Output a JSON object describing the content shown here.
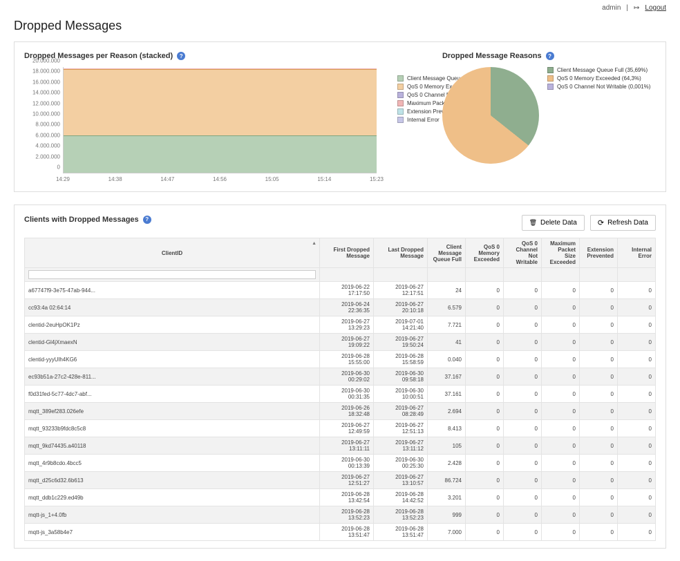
{
  "header": {
    "user": "admin",
    "logout_label": "Logout"
  },
  "page": {
    "title": "Dropped Messages"
  },
  "stacked": {
    "title": "Dropped Messages per Reason (stacked)",
    "legend": [
      "Client Message Queue Full",
      "QoS 0 Memory Exceeded",
      "QoS 0 Channel Not Writable",
      "Maximum Packet Size Exceeded",
      "Extension Prevented",
      "Internal Error"
    ]
  },
  "pie": {
    "title": "Dropped Message Reasons",
    "legend": {
      "a": "Client Message Queue Full (35,69%)",
      "b": "QoS 0 Memory Exceeded (64,3%)",
      "c": "QoS 0 Channel Not Writable (0,001%)"
    }
  },
  "chart_data": [
    {
      "type": "area",
      "title": "Dropped Messages per Reason (stacked)",
      "x_labels": [
        "14:29",
        "14:38",
        "14:47",
        "14:56",
        "15:05",
        "15:14",
        "15:23"
      ],
      "y_ticks": [
        "0",
        "2.000.000",
        "4.000.000",
        "6.000.000",
        "8.000.000",
        "10.000.000",
        "12.000.000",
        "14.000.000",
        "16.000.000",
        "18.000.000",
        "20.000.000"
      ],
      "ylim": [
        0,
        20000000
      ],
      "series": [
        {
          "name": "Client Message Queue Full",
          "color": "#b6d0b6",
          "approx_constant": 7000000
        },
        {
          "name": "QoS 0 Memory Exceeded",
          "color": "#f3cfa2",
          "approx_constant": 12600000
        },
        {
          "name": "QoS 0 Channel Not Writable",
          "color": "#b9b2dc",
          "approx_constant": 0
        },
        {
          "name": "Maximum Packet Size Exceeded",
          "color": "#f0b6b6",
          "approx_constant": 0
        },
        {
          "name": "Extension Prevented",
          "color": "#bfe3e8",
          "approx_constant": 0
        },
        {
          "name": "Internal Error",
          "color": "#c7c7e8",
          "approx_constant": 0
        }
      ],
      "note": "stacked total ≈ 19.6M across full time range; top edge shows thin traces for remaining series"
    },
    {
      "type": "pie",
      "title": "Dropped Message Reasons",
      "slices": [
        {
          "name": "Client Message Queue Full",
          "pct": 35.69,
          "color": "#8fae8f"
        },
        {
          "name": "QoS 0 Memory Exceeded",
          "pct": 64.3,
          "color": "#efbf88"
        },
        {
          "name": "QoS 0 Channel Not Writable",
          "pct": 0.001,
          "color": "#b9b2dc"
        }
      ]
    }
  ],
  "clients": {
    "title": "Clients with Dropped Messages",
    "buttons": {
      "delete": "Delete Data",
      "refresh": "Refresh Data"
    },
    "columns": {
      "client": "ClientID",
      "first": "First Dropped Message",
      "last": "Last Dropped Message",
      "queue": "Client Message Queue Full",
      "mem": "QoS 0 Memory Exceeded",
      "chan": "QoS 0 Channel Not Writable",
      "pkt": "Maximum Packet Size Exceeded",
      "ext": "Extension Prevented",
      "err": "Internal Error"
    },
    "filter_placeholder": "",
    "rows": [
      {
        "client": "a67747f9-3e75-47ab-944...",
        "first": "2019-06-22 17:17:50",
        "last": "2019-06-27 12:17:51",
        "queue": "24",
        "mem": "0",
        "chan": "0",
        "pkt": "0",
        "ext": "0",
        "err": "0"
      },
      {
        "client": "cc93:4a 02:64:14",
        "first": "2019-06-24 22:36:35",
        "last": "2019-06-27 20:10:18",
        "queue": "6.579",
        "mem": "0",
        "chan": "0",
        "pkt": "0",
        "ext": "0",
        "err": "0"
      },
      {
        "client": "clentid-2euHpOK1Pz",
        "first": "2019-06-27 13:29:23",
        "last": "2019-07-01 14:21:40",
        "queue": "7.721",
        "mem": "0",
        "chan": "0",
        "pkt": "0",
        "ext": "0",
        "err": "0"
      },
      {
        "client": "clentid-Gl4jXmaexN",
        "first": "2019-06-27 19:09:22",
        "last": "2019-06-27 19:50:24",
        "queue": "41",
        "mem": "0",
        "chan": "0",
        "pkt": "0",
        "ext": "0",
        "err": "0"
      },
      {
        "client": "clentid-yyyUlh4KG6",
        "first": "2019-06-28 15:55:00",
        "last": "2019-06-28 15:58:59",
        "queue": "0.040",
        "mem": "0",
        "chan": "0",
        "pkt": "0",
        "ext": "0",
        "err": "0"
      },
      {
        "client": "ec93b51a-27c2-428e-811...",
        "first": "2019-06-30 00:29:02",
        "last": "2019-06-30 09:58:18",
        "queue": "37.167",
        "mem": "0",
        "chan": "0",
        "pkt": "0",
        "ext": "0",
        "err": "0"
      },
      {
        "client": "f0d31fed-5c77-4dc7-abf...",
        "first": "2019-06-30 00:31:35",
        "last": "2019-06-30 10:00:51",
        "queue": "37.161",
        "mem": "0",
        "chan": "0",
        "pkt": "0",
        "ext": "0",
        "err": "0"
      },
      {
        "client": "mqtt_389ef283.026efe",
        "first": "2019-06-26 18:32:48",
        "last": "2019-06-27 08:28:49",
        "queue": "2.694",
        "mem": "0",
        "chan": "0",
        "pkt": "0",
        "ext": "0",
        "err": "0"
      },
      {
        "client": "mqtt_93233b9fdc8c5c8",
        "first": "2019-06-27 12:49:59",
        "last": "2019-06-27 12:51:13",
        "queue": "8.413",
        "mem": "0",
        "chan": "0",
        "pkt": "0",
        "ext": "0",
        "err": "0"
      },
      {
        "client": "mqtt_9kd74435.a40118",
        "first": "2019-06-27 13:11:11",
        "last": "2019-06-27 13:11:12",
        "queue": "105",
        "mem": "0",
        "chan": "0",
        "pkt": "0",
        "ext": "0",
        "err": "0"
      },
      {
        "client": "mqtt_4r9b8cdo.4bcc5",
        "first": "2019-06-30 00:13:39",
        "last": "2019-06-30 00:25:30",
        "queue": "2.428",
        "mem": "0",
        "chan": "0",
        "pkt": "0",
        "ext": "0",
        "err": "0"
      },
      {
        "client": "mqtt_d25c6d32.6b613",
        "first": "2019-06-27 12:51:27",
        "last": "2019-06-27 13:10:57",
        "queue": "86.724",
        "mem": "0",
        "chan": "0",
        "pkt": "0",
        "ext": "0",
        "err": "0"
      },
      {
        "client": "mqtt_ddb1c229.ed49b",
        "first": "2019-06-28 13:42:54",
        "last": "2019-06-28 14:42:52",
        "queue": "3.201",
        "mem": "0",
        "chan": "0",
        "pkt": "0",
        "ext": "0",
        "err": "0"
      },
      {
        "client": "mqtt-js_1+4.0fb",
        "first": "2019-06-28 13:52:23",
        "last": "2019-06-28 13:52:23",
        "queue": "999",
        "mem": "0",
        "chan": "0",
        "pkt": "0",
        "ext": "0",
        "err": "0"
      },
      {
        "client": "mqtt-js_3a58b4e7",
        "first": "2019-06-28 13:51:47",
        "last": "2019-06-28 13:51:47",
        "queue": "7.000",
        "mem": "0",
        "chan": "0",
        "pkt": "0",
        "ext": "0",
        "err": "0"
      }
    ]
  }
}
